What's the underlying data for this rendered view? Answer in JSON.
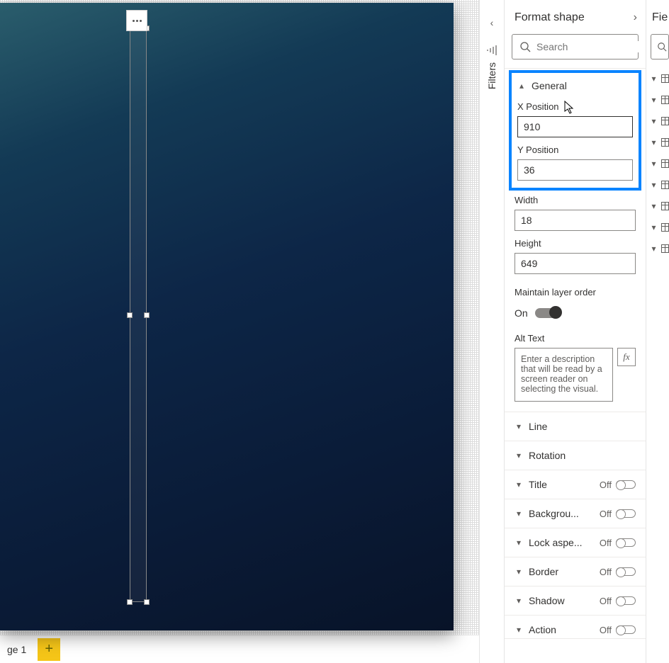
{
  "page_tab": "ge 1",
  "filters_label": "Filters",
  "format": {
    "title": "Format shape",
    "search_placeholder": "Search",
    "sections": {
      "general": {
        "title": "General",
        "x_label": "X Position",
        "x_value": "910",
        "y_label": "Y Position",
        "y_value": "36",
        "width_label": "Width",
        "width_value": "18",
        "height_label": "Height",
        "height_value": "649",
        "maintain_label": "Maintain layer order",
        "maintain_state": "On",
        "alt_label": "Alt Text",
        "alt_placeholder": "Enter a description that will be read by a screen reader on selecting the visual."
      },
      "line": "Line",
      "rotation": "Rotation",
      "title_s": "Title",
      "background": "Backgrou...",
      "lock": "Lock aspe...",
      "border": "Border",
      "shadow": "Shadow",
      "action": "Action",
      "off": "Off"
    }
  },
  "fields": {
    "title": "Fie"
  }
}
